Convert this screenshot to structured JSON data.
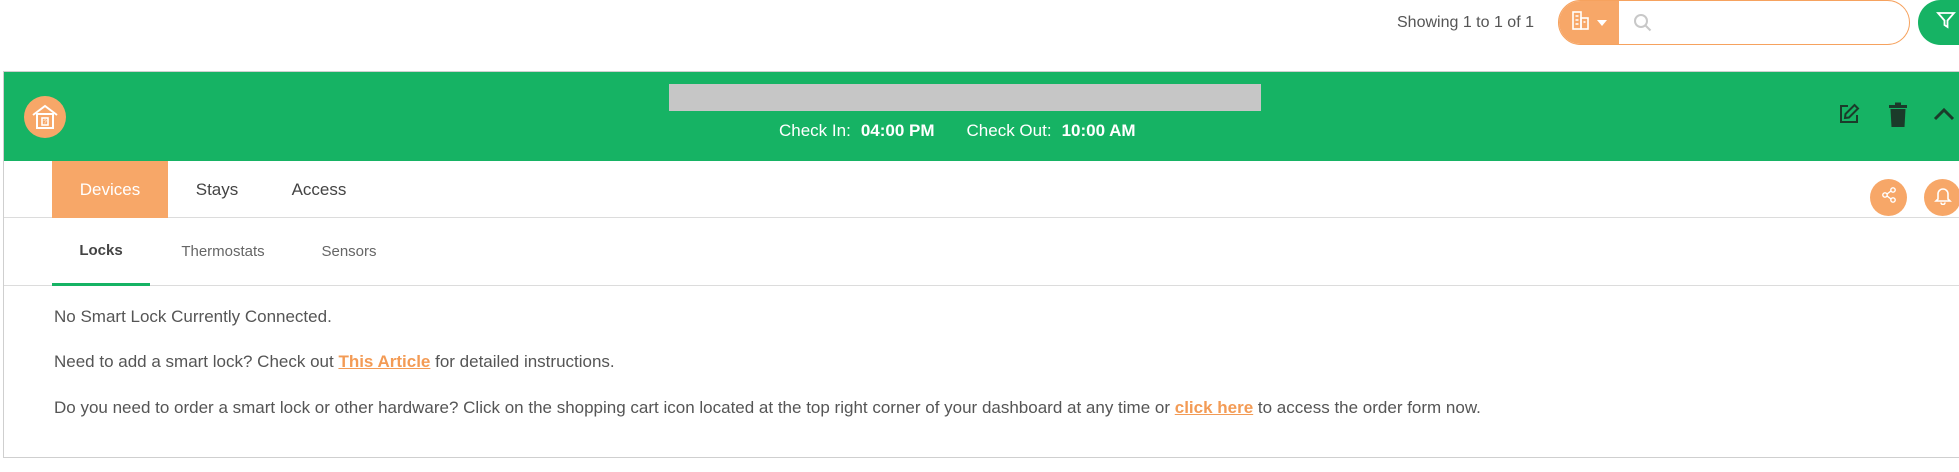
{
  "toolbar": {
    "showing_text": "Showing 1 to 1 of 1",
    "search_placeholder": "",
    "search_value": ""
  },
  "property": {
    "check_in_label": "Check In:",
    "check_in_value": "04:00 PM",
    "check_out_label": "Check Out:",
    "check_out_value": "10:00 AM"
  },
  "tabs": [
    {
      "label": "Devices",
      "active": true
    },
    {
      "label": "Stays",
      "active": false
    },
    {
      "label": "Access",
      "active": false
    }
  ],
  "subtabs": [
    {
      "label": "Locks",
      "active": true
    },
    {
      "label": "Thermostats",
      "active": false
    },
    {
      "label": "Sensors",
      "active": false
    }
  ],
  "content": {
    "line1": "No Smart Lock Currently Connected.",
    "line2_pre": "Need to add a smart lock? Check out ",
    "line2_link": "This Article",
    "line2_post": " for detailed instructions.",
    "line3_pre": "Do you need to order a smart lock or other hardware? Click on the shopping cart icon located at the top right corner of your dashboard at any time or ",
    "line3_link": "click here",
    "line3_post": " to access the order form now."
  },
  "colors": {
    "brand_green": "#16b364",
    "accent_orange": "#f7a768",
    "link_orange": "#f39b55"
  },
  "icons": {
    "search_type": "building-icon",
    "search": "search-icon",
    "filter": "filter-icon",
    "property_avatar": "house-icon",
    "edit": "edit-icon",
    "delete": "trash-icon",
    "collapse": "chevron-up-icon",
    "share": "share-icon",
    "notify": "bell-icon"
  }
}
